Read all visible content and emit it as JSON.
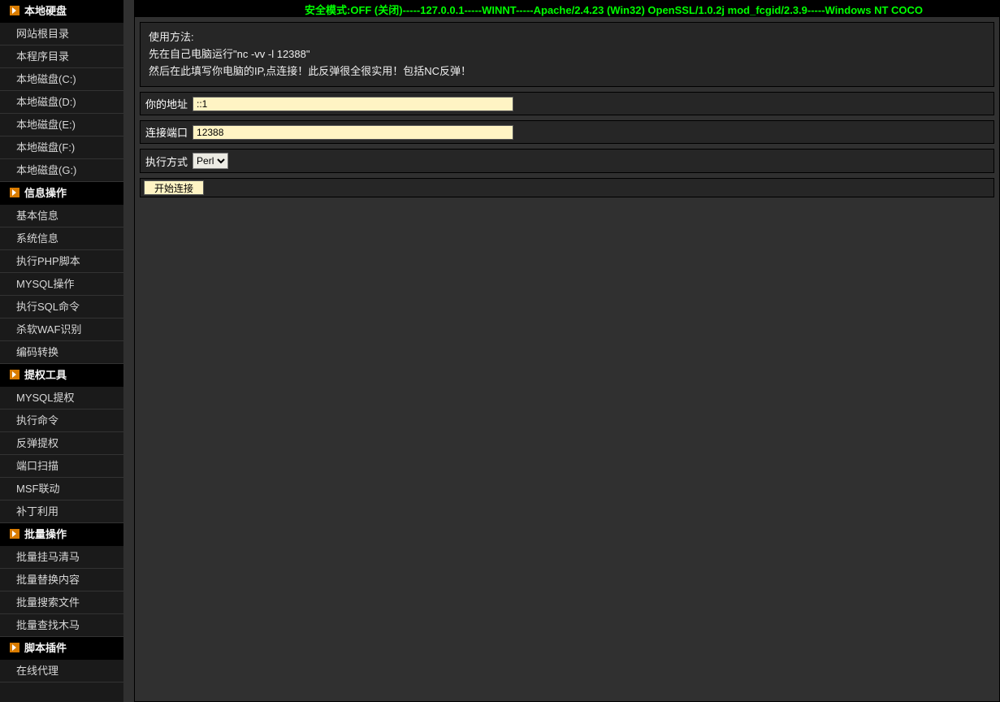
{
  "topbar": {
    "text": "安全模式:OFF (关闭)-----127.0.0.1-----WINNT-----Apache/2.4.23 (Win32) OpenSSL/1.0.2j mod_fcgid/2.3.9-----Windows NT COCO"
  },
  "sidebar": {
    "groups": [
      {
        "title": "本地硬盘",
        "items": [
          "网站根目录",
          "本程序目录",
          "本地磁盘(C:)",
          "本地磁盘(D:)",
          "本地磁盘(E:)",
          "本地磁盘(F:)",
          "本地磁盘(G:)"
        ]
      },
      {
        "title": "信息操作",
        "items": [
          "基本信息",
          "系统信息",
          "执行PHP脚本",
          "MYSQL操作",
          "执行SQL命令",
          "杀软WAF识别",
          "编码转换"
        ]
      },
      {
        "title": "提权工具",
        "items": [
          "MYSQL提权",
          "执行命令",
          "反弹提权",
          "端口扫描",
          "MSF联动",
          "补丁利用"
        ]
      },
      {
        "title": "批量操作",
        "items": [
          "批量挂马清马",
          "批量替换内容",
          "批量搜索文件",
          "批量查找木马"
        ]
      },
      {
        "title": "脚本插件",
        "items": [
          "在线代理"
        ]
      }
    ]
  },
  "main": {
    "instructions": {
      "line1": "使用方法:",
      "line2": "先在自己电脑运行\"nc -vv -l 12388\"",
      "line3": "然后在此填写你电脑的IP,点连接！此反弹很全很实用！包括NC反弹！"
    },
    "address_label": "你的地址",
    "address_value": "::1",
    "port_label": "连接端口",
    "port_value": "12388",
    "method_label": "执行方式",
    "method_value": "Perl",
    "method_options": [
      "Perl"
    ],
    "submit_label": "开始连接"
  }
}
